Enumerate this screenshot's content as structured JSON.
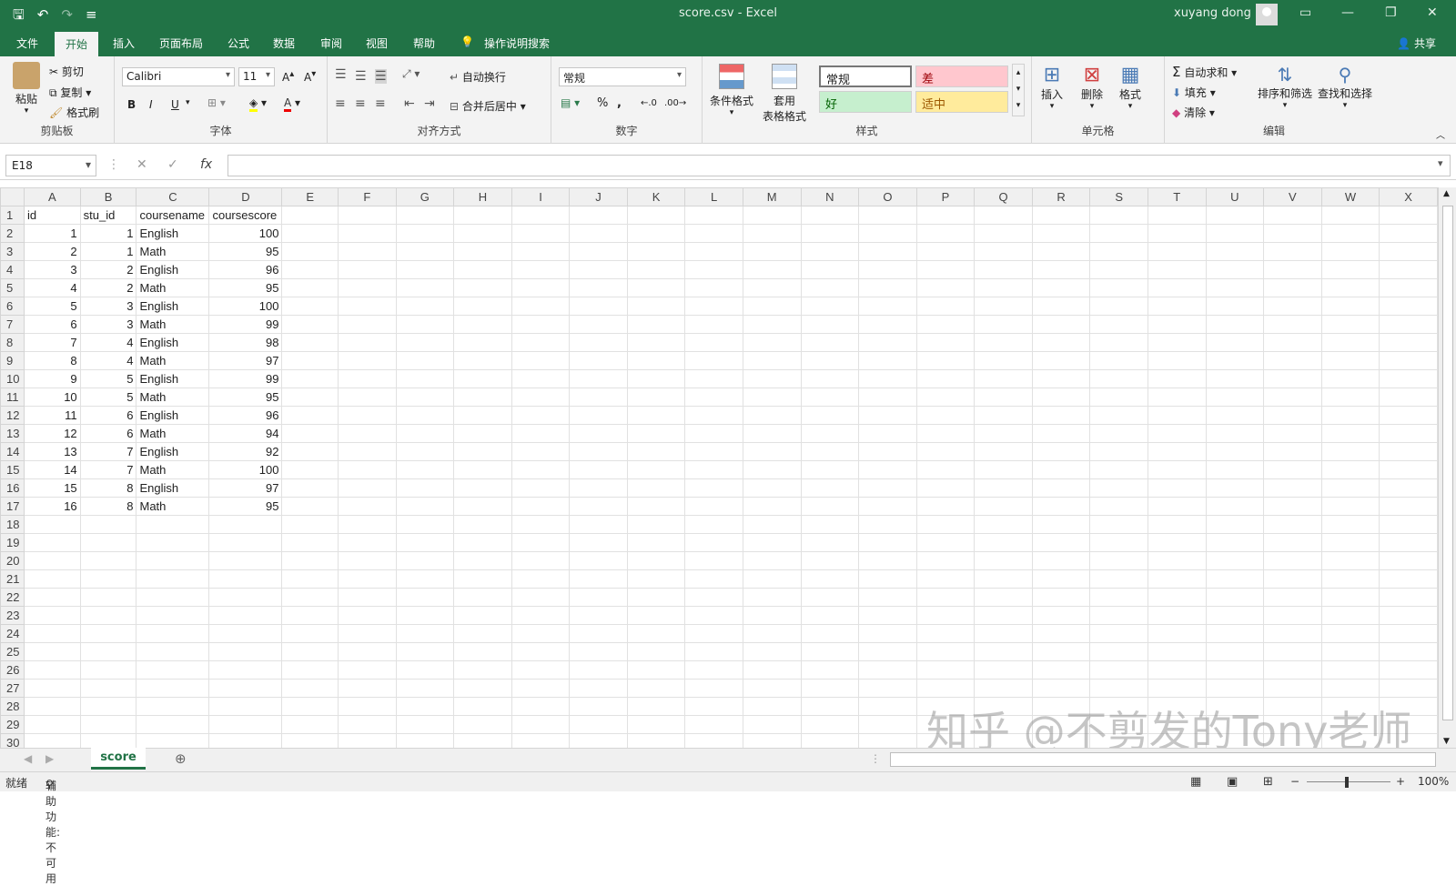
{
  "title_bar": {
    "title": "score.csv  -  Excel",
    "user": "xuyang dong",
    "qat_save_icon": "save-icon",
    "qat_undo_icon": "undo-icon",
    "qat_redo_icon": "redo-icon"
  },
  "tabs": [
    "文件",
    "开始",
    "插入",
    "页面布局",
    "公式",
    "数据",
    "审阅",
    "视图",
    "帮助"
  ],
  "tell_me": "操作说明搜索",
  "share": "共享",
  "ribbon": {
    "clipboard": {
      "paste": "粘贴",
      "cut": "剪切",
      "copy": "复制",
      "format_painter": "格式刷",
      "label": "剪贴板"
    },
    "font": {
      "name": "Calibri",
      "size": "11",
      "label": "字体",
      "bold": "B",
      "italic": "I",
      "underline": "U"
    },
    "alignment": {
      "wrap": "自动换行",
      "merge": "合并后居中",
      "label": "对齐方式"
    },
    "number": {
      "format": "常规",
      "percent": "%",
      "comma": ",",
      "label": "数字"
    },
    "styles": {
      "conditional": "条件格式",
      "table1": "套用",
      "table2": "表格格式",
      "normal": "常规",
      "bad": "差",
      "good": "好",
      "neutral": "适中",
      "label": "样式"
    },
    "cells": {
      "insert": "插入",
      "delete": "删除",
      "format": "格式",
      "label": "单元格"
    },
    "editing": {
      "autosum": "自动求和",
      "fill": "填充",
      "clear": "清除",
      "sort": "排序和筛选",
      "find": "查找和选择",
      "label": "编辑"
    }
  },
  "formula_bar": {
    "name_box": "E18",
    "cancel": "✕",
    "enter": "✓",
    "fx": "fx",
    "value": ""
  },
  "columns": [
    "A",
    "B",
    "C",
    "D",
    "E",
    "F",
    "G",
    "H",
    "I",
    "J",
    "K",
    "L",
    "M",
    "N",
    "O",
    "P",
    "Q",
    "R",
    "S",
    "T",
    "U",
    "V",
    "W",
    "X"
  ],
  "header_row": [
    "id",
    "stu_id",
    "coursename",
    "coursescore"
  ],
  "rows": [
    [
      1,
      1,
      "English",
      100
    ],
    [
      2,
      1,
      "Math",
      95
    ],
    [
      3,
      2,
      "English",
      96
    ],
    [
      4,
      2,
      "Math",
      95
    ],
    [
      5,
      3,
      "English",
      100
    ],
    [
      6,
      3,
      "Math",
      99
    ],
    [
      7,
      4,
      "English",
      98
    ],
    [
      8,
      4,
      "Math",
      97
    ],
    [
      9,
      5,
      "English",
      99
    ],
    [
      10,
      5,
      "Math",
      95
    ],
    [
      11,
      6,
      "English",
      96
    ],
    [
      12,
      6,
      "Math",
      94
    ],
    [
      13,
      7,
      "English",
      92
    ],
    [
      14,
      7,
      "Math",
      100
    ],
    [
      15,
      8,
      "English",
      97
    ],
    [
      16,
      8,
      "Math",
      95
    ]
  ],
  "row_count": 30,
  "sheet_tab": "score",
  "status": {
    "ready": "就绪",
    "accessibility": "辅助功能: 不可用",
    "zoom": "100%"
  },
  "watermark": "知乎 @不剪发的Tony老师",
  "colors": {
    "accent": "#217346",
    "bad_bg": "#ffc7ce",
    "good_bg": "#c6efce",
    "neutral_bg": "#ffeb9c"
  }
}
